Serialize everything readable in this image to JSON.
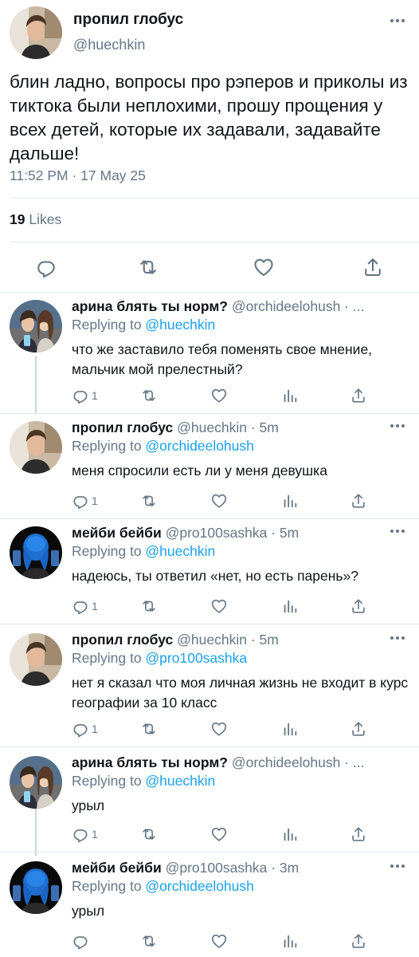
{
  "main_tweet": {
    "name": "пропил глобус",
    "handle": "@huechkin",
    "text": "блин ладно, вопросы про рэперов и приколы из тиктока были неплохими, прошу прощения у всех детей, которые их задавали, задавайте дальше!",
    "timestamp": "11:52 PM · 17 May 25",
    "likes_count": "19",
    "likes_label": "Likes",
    "actions": [
      "reply-icon",
      "retweet-icon",
      "like-icon",
      "share-icon"
    ]
  },
  "replies": [
    {
      "name": "арина блять ты норм?",
      "meta": " @orchideelohush · ...",
      "replying_label": "Replying to ",
      "replying_to": "@huechkin",
      "text": "что же заставило тебя поменять свое мнение, мальчик мой прелестный?",
      "reply_count": "1",
      "avatar": "arina"
    },
    {
      "name": "пропил глобус",
      "meta": " @huechkin · 5m",
      "replying_label": "Replying to ",
      "replying_to": "@orchideelohush",
      "text": "меня спросили есть ли у меня девушка",
      "reply_count": "1",
      "avatar": "globus"
    },
    {
      "name": "мейби бейби",
      "meta": " @pro100sashka · 5m",
      "replying_label": "Replying to ",
      "replying_to": "@huechkin",
      "text": "надеюсь, ты ответил «нет, но есть парень»?",
      "reply_count": "1",
      "avatar": "maybe"
    },
    {
      "name": "пропил глобус",
      "meta": " @huechkin · 5m",
      "replying_label": "Replying to ",
      "replying_to": "@pro100sashka",
      "text": "нет я сказал что моя личная жизнь не входит в курс географии за 10 класс",
      "reply_count": "1",
      "avatar": "globus"
    },
    {
      "name": "арина блять ты норм?",
      "meta": " @orchideelohush · ...",
      "replying_label": "Replying to ",
      "replying_to": "@huechkin",
      "text": "урыл",
      "reply_count": "1",
      "avatar": "arina"
    },
    {
      "name": "мейби бейби",
      "meta": " @pro100sashka · 3m",
      "replying_label": "Replying to ",
      "replying_to": "@orchideelohush",
      "text": "урыл",
      "reply_count": "",
      "avatar": "maybe"
    }
  ],
  "colors": {
    "text": "#0f1419",
    "secondary": "#657786",
    "link": "#1da1f2",
    "divider": "#e1e8ed",
    "thread_line": "#ccd6dd"
  }
}
